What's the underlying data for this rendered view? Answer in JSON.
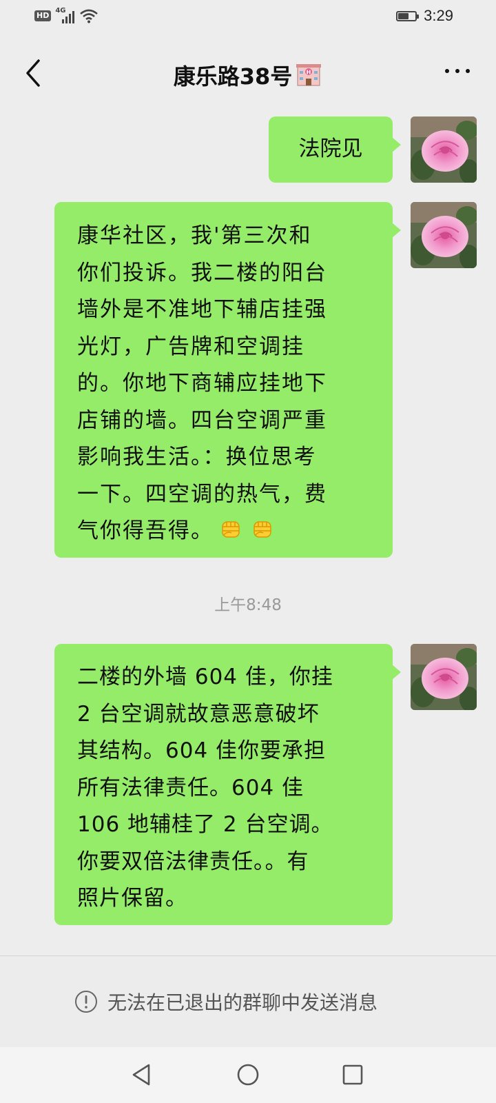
{
  "status_bar": {
    "network_badge": "HD",
    "network_type": "4G",
    "time": "3:29",
    "battery_level": 0.6
  },
  "header": {
    "title": "康乐路38号",
    "title_emoji_icon": "hotel-icon"
  },
  "messages": [
    {
      "sender": "self",
      "avatar_icon": "pink-rose-avatar",
      "text": "法院见"
    },
    {
      "sender": "self",
      "avatar_icon": "pink-rose-avatar",
      "text": "康华社区，我'第三次和\n你们投诉。我二楼的阳台\n墙外是不准地下辅店挂强\n光灯，广告牌和空调挂\n的。你地下商辅应挂地下\n店铺的墙。四台空调严重\n影响我生活。：换位思考\n一下。四空调的热气，费\n气你得吾得。",
      "emojis": [
        "fist-emoji",
        "fist-emoji"
      ]
    },
    {
      "sender": "self",
      "avatar_icon": "pink-rose-avatar",
      "text": "二楼的外墙 604 佳，你挂\n2 台空调就故意恶意破坏\n其结构。604 佳你要承担\n所有法律责任。604 佳\n106 地辅桂了 2 台空调。\n你要双倍法律责任。。有\n照片保留。"
    }
  ],
  "timestamp": "上午8:48",
  "footer_notice": {
    "icon": "exclamation-circle-icon",
    "text": "无法在已退出的群聊中发送消息"
  },
  "colors": {
    "bubble_self": "#95ec69",
    "background": "#ededed",
    "timestamp_text": "#999999"
  }
}
